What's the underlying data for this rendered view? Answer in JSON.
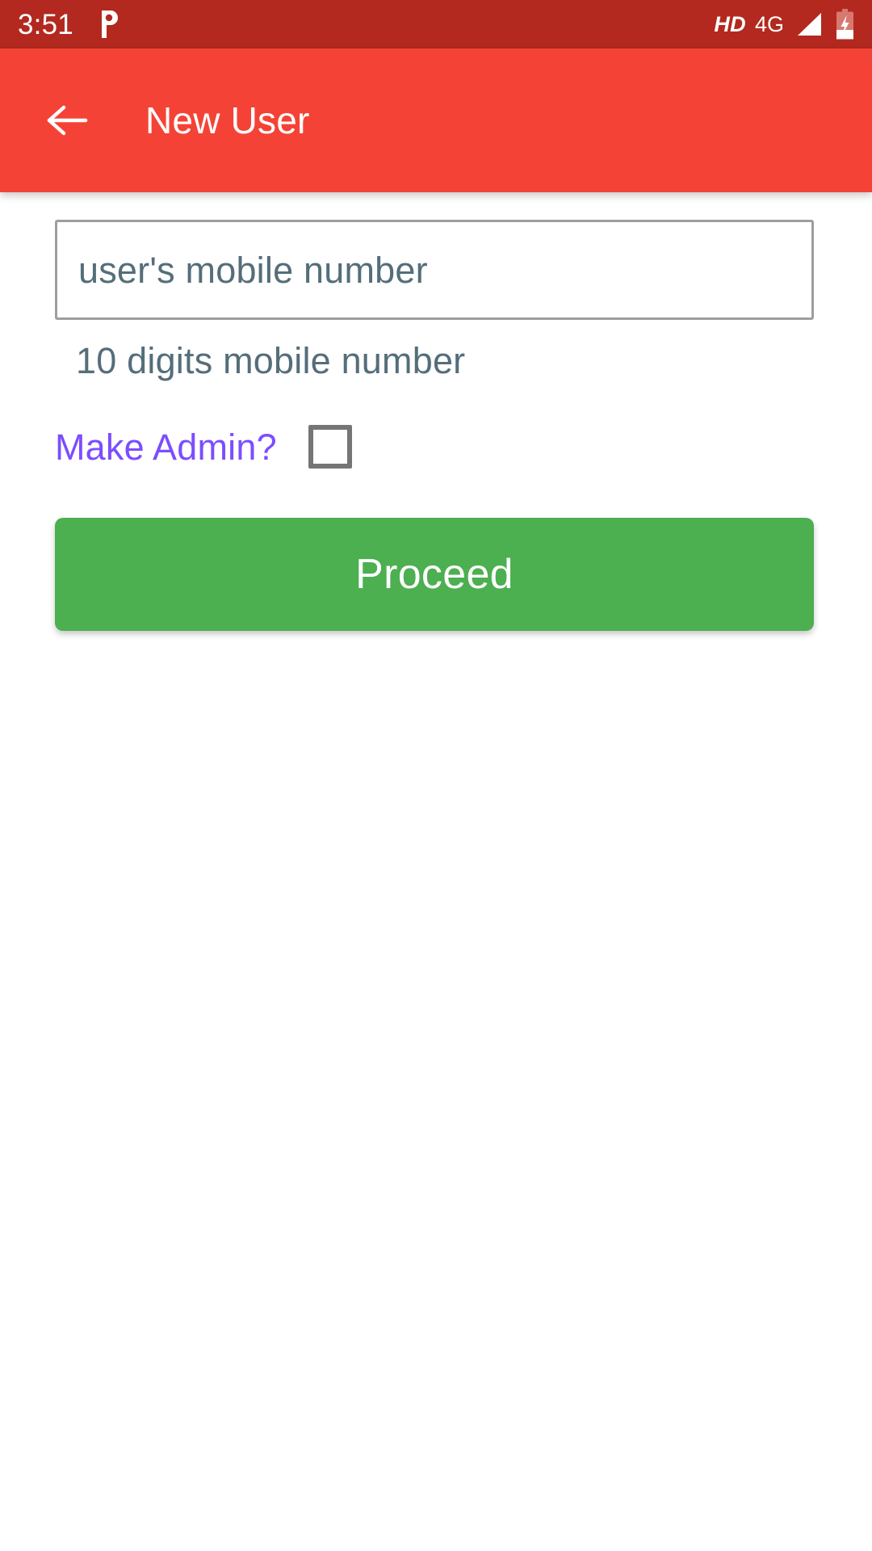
{
  "status_bar": {
    "time": "3:51",
    "notification_icon": "p-app-notification-icon",
    "hd_label": "HD",
    "network_label": "4G",
    "signal_icon": "signal-bars-icon",
    "battery_icon": "battery-charging-icon",
    "background_color": "#b3291f",
    "text_color": "#ffffff"
  },
  "app_bar": {
    "back_icon": "arrow-left-icon",
    "title": "New User",
    "background_color": "#f44336",
    "text_color": "#ffffff"
  },
  "form": {
    "mobile_input": {
      "value": "",
      "placeholder": "user's mobile number",
      "border_color": "#9e9e9e",
      "text_color": "#546e7a"
    },
    "helper_text": "10 digits mobile number",
    "admin": {
      "label": "Make Admin?",
      "label_color": "#7c4dff",
      "checked": false,
      "checkbox_border_color": "#757575"
    },
    "proceed_button": {
      "label": "Proceed",
      "background_color": "#4caf50",
      "text_color": "#ffffff"
    }
  }
}
